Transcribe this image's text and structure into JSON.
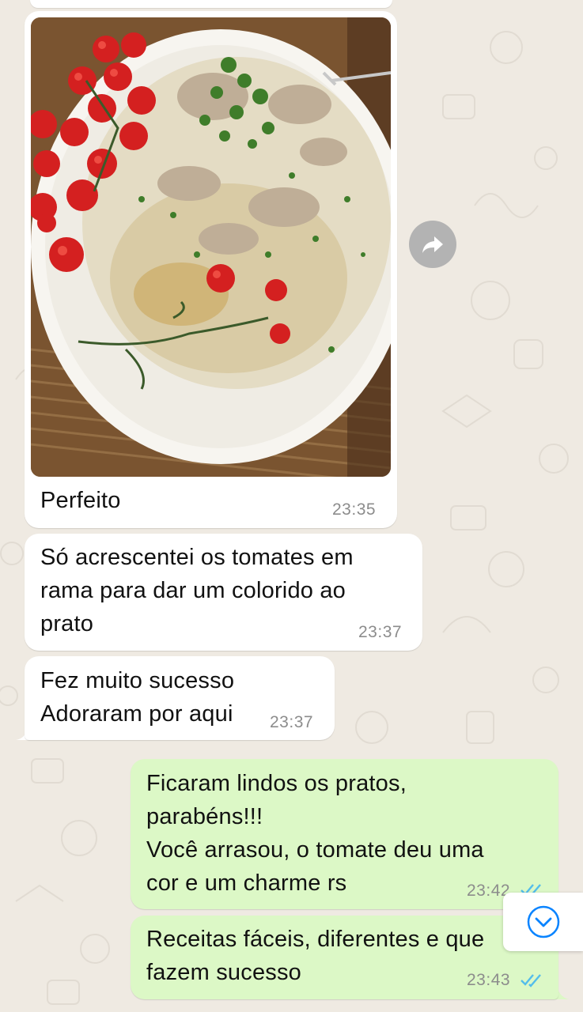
{
  "messages": [
    {
      "type": "image",
      "caption": "Perfeito",
      "time": "23:35"
    },
    {
      "type": "incoming",
      "text": "Só acrescentei os tomates em\nrama para dar um colorido ao\nprato",
      "time": "23:37"
    },
    {
      "type": "incoming",
      "text": "Fez muito sucesso\nAdoraram por aqui",
      "time": "23:37"
    },
    {
      "type": "outgoing",
      "text": "Ficaram lindos os pratos,\nparabéns!!!\nVocê arrasou, o tomate deu uma\ncor e um charme rs",
      "time": "23:42",
      "status": "read"
    },
    {
      "type": "outgoing",
      "text": "Receitas fáceis, diferentes e que\nfazem sucesso",
      "time": "23:43",
      "status": "read"
    }
  ],
  "icons": {
    "forward": "forward-arrow-icon",
    "scroll": "chevron-down-icon",
    "read": "double-check-icon"
  },
  "colors": {
    "background": "#efeae2",
    "incoming_bubble": "#ffffff",
    "outgoing_bubble": "#dcf8c6",
    "read_ticks": "#53bdeb",
    "scroll_icon": "#0a84ff"
  }
}
